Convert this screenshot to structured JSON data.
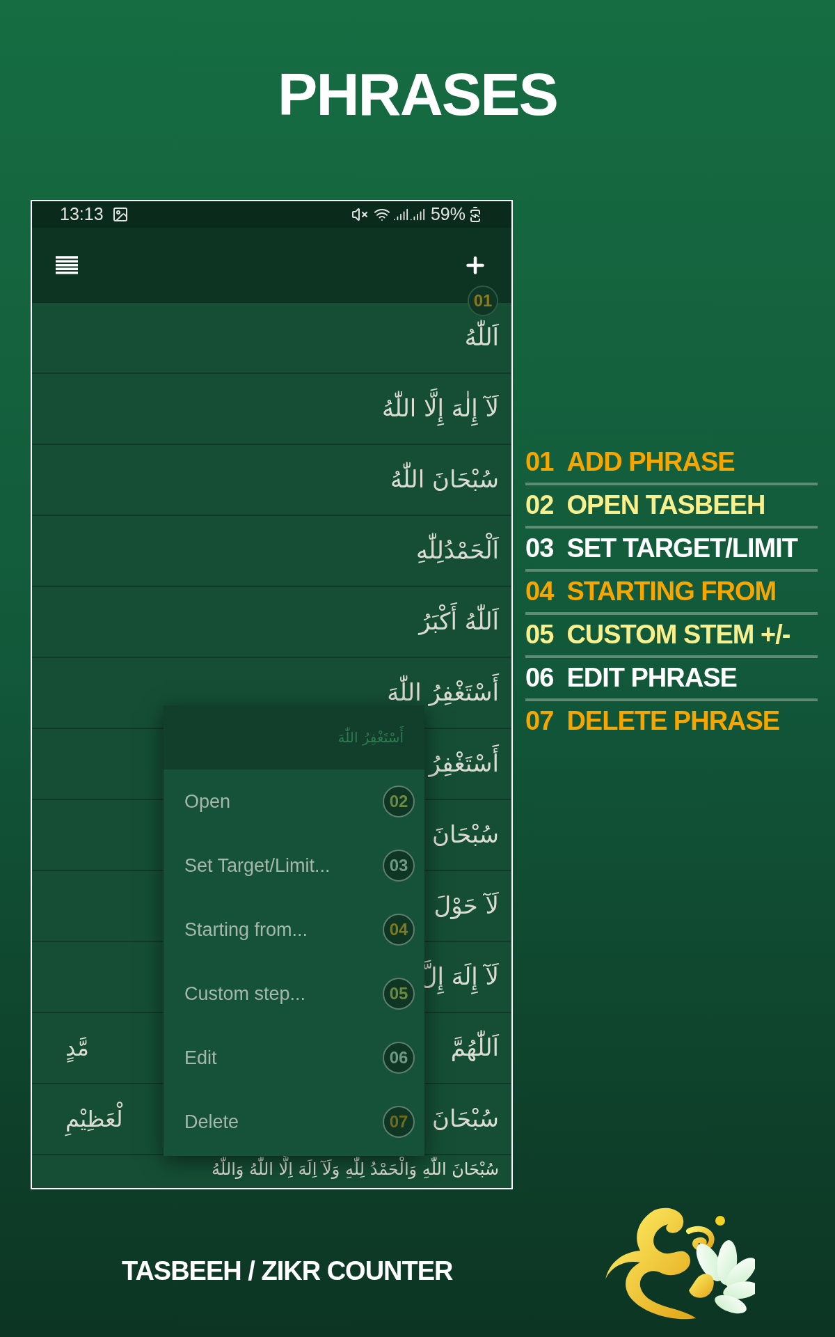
{
  "title": "PHRASES",
  "phone": {
    "status_bar": {
      "time": "13:13",
      "battery": "59%"
    },
    "add_badge": {
      "label": "01",
      "color": "#8c7a1a"
    },
    "phrases": [
      {
        "right": "اَللّٰهُ"
      },
      {
        "right": "لَآ إِلٰهَ إِلَّا اللّٰهُ"
      },
      {
        "right": "سُبْحَانَ اللّٰهُ"
      },
      {
        "right": "اَلْحَمْدُلِلّٰهِ"
      },
      {
        "right": "اَللّٰهُ أَكْبَرُ"
      },
      {
        "right": "أَسْتَغْفِرُ اللّٰهَ"
      },
      {
        "right": "أَسْتَغْفِرُ"
      },
      {
        "right": "سُبْحَانَ"
      },
      {
        "right": "لَآ حَوْلَ"
      },
      {
        "right": "لَآ إِلَهَ إِلَّ"
      },
      {
        "right": "اَللّٰهُمَّ",
        "left": "مَّدٍ"
      },
      {
        "right": "سُبْحَانَ",
        "left": "لْعَظِيْمِ"
      },
      {
        "right": "سُبْحَانَ اللّٰهِ وَالْحَمْدُ لِلّٰهِ وَلَآ اِلَهَ اِلَّا اللّٰهُ وَاللّٰهُ"
      }
    ],
    "menu": {
      "title": "أَسْتَغْفِرُ اللّٰهَ",
      "items": [
        {
          "label": "Open",
          "badge": "02",
          "color": "#6b8a44"
        },
        {
          "label": "Set Target/Limit...",
          "badge": "03",
          "color": "#6f9a82"
        },
        {
          "label": "Starting from...",
          "badge": "04",
          "color": "#7e7a1e"
        },
        {
          "label": "Custom step...",
          "badge": "05",
          "color": "#6b8a44"
        },
        {
          "label": "Edit",
          "badge": "06",
          "color": "#6f9a82"
        },
        {
          "label": "Delete",
          "badge": "07",
          "color": "#6e6c1e"
        }
      ]
    }
  },
  "legend": [
    {
      "number": "01",
      "label": "ADD PHRASE",
      "color": "#f7a600"
    },
    {
      "number": "02",
      "label": "OPEN TASBEEH",
      "color": "#f9ef8c"
    },
    {
      "number": "03",
      "label": "SET TARGET/LIMIT",
      "color": "#ffffff"
    },
    {
      "number": "04",
      "label": "STARTING FROM",
      "color": "#f7a600"
    },
    {
      "number": "05",
      "label": "CUSTOM STEM +/-",
      "color": "#f9ef8c"
    },
    {
      "number": "06",
      "label": "EDIT PHRASE",
      "color": "#ffffff"
    },
    {
      "number": "07",
      "label": "DELETE PHRASE",
      "color": "#f7a600"
    }
  ],
  "footer": "TASBEEH / ZIKR COUNTER"
}
